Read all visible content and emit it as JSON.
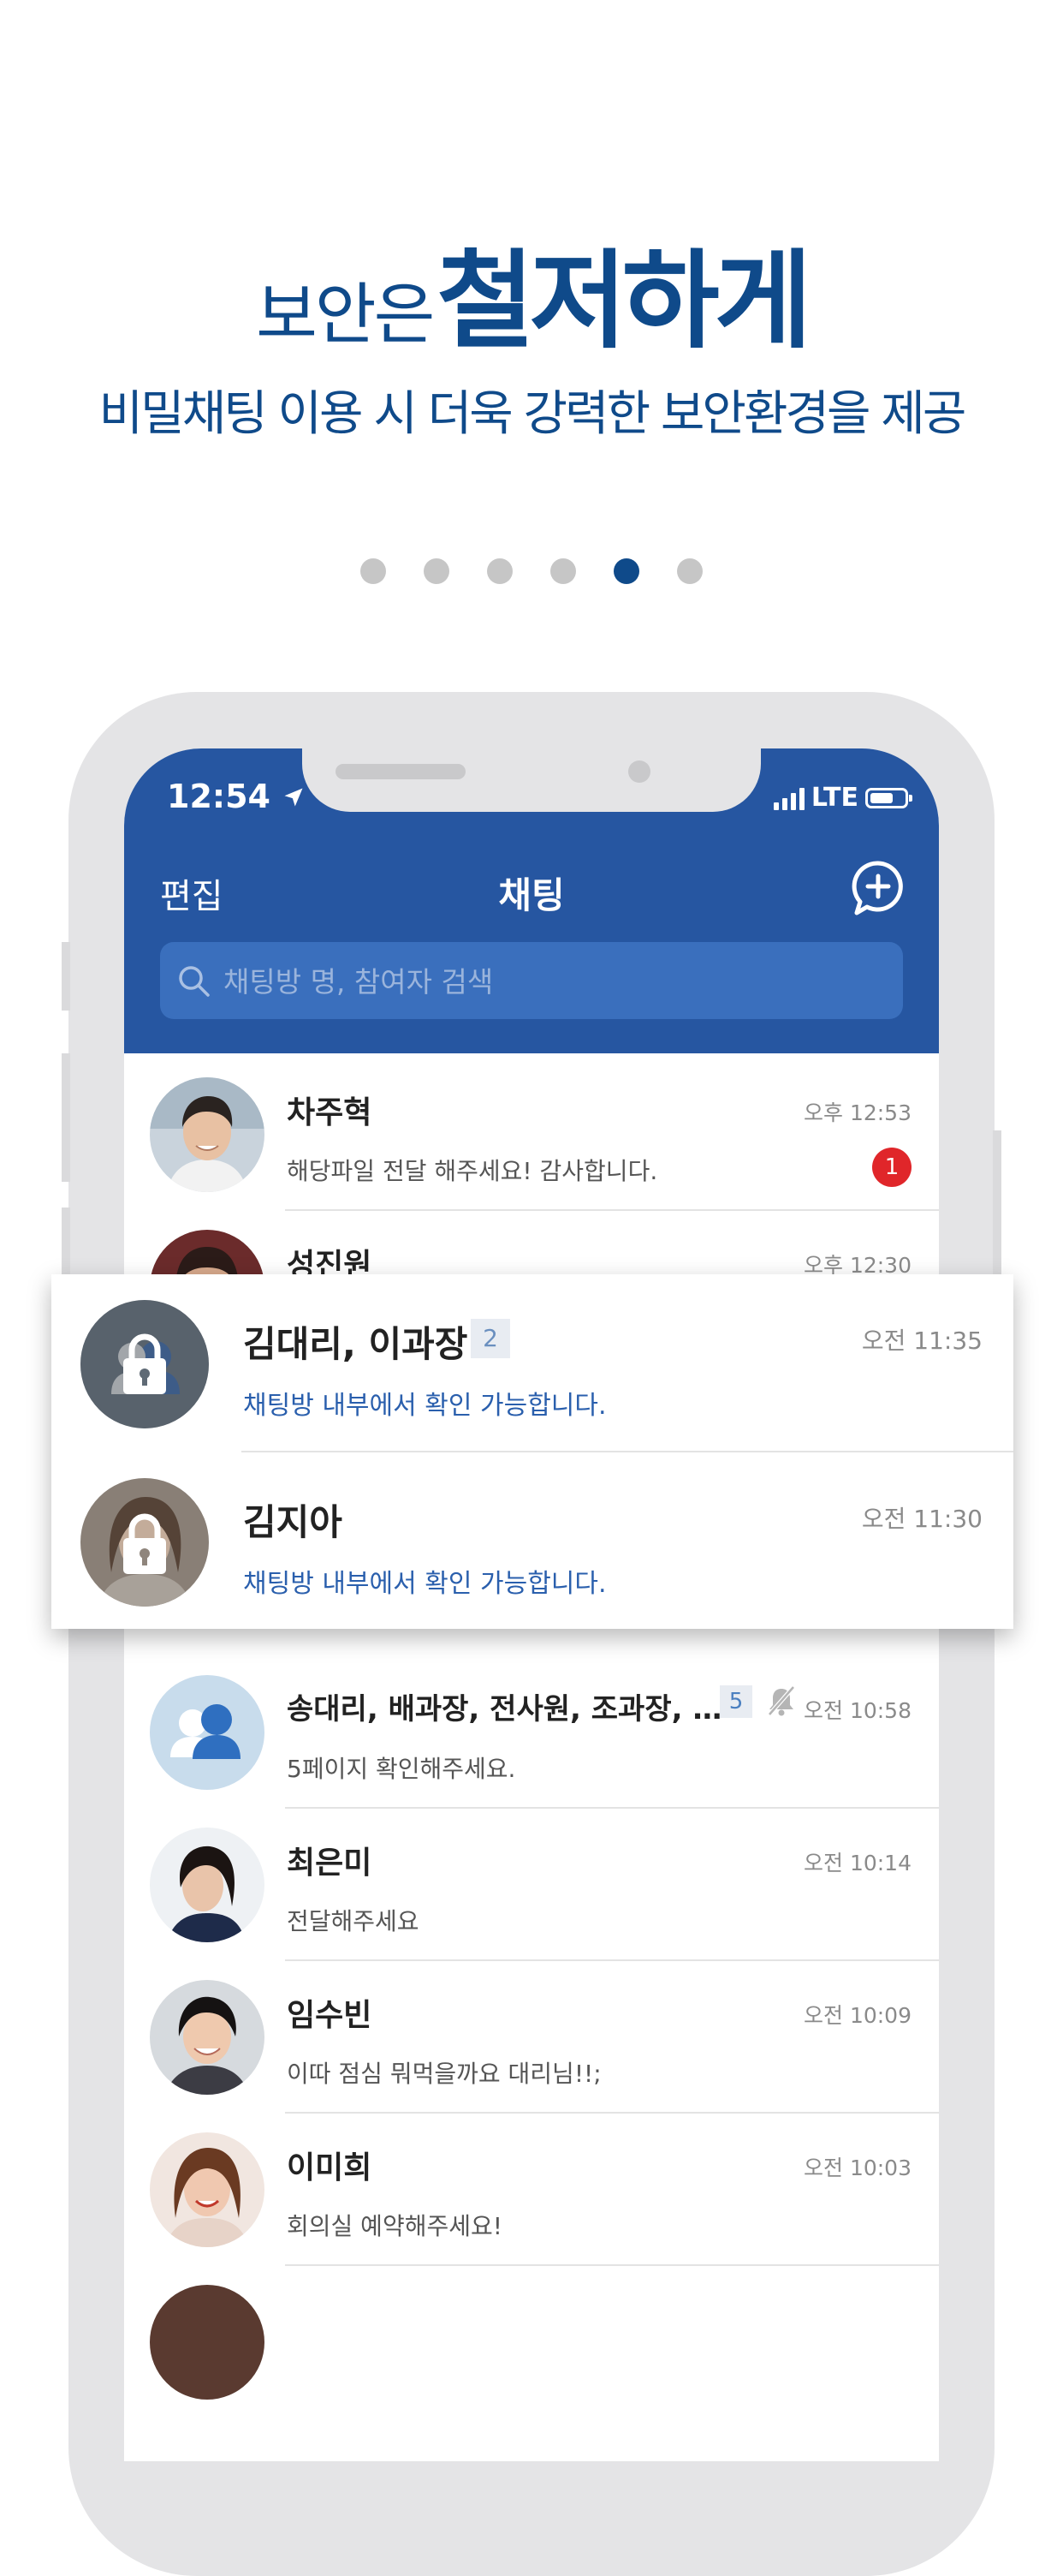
{
  "promo": {
    "headline_small": "보안은",
    "headline_big": "철저하게",
    "subheadline": "비밀채팅 이용 시 더욱 강력한 보안환경을 제공",
    "page_dots": 6,
    "active_dot": 5
  },
  "status_bar": {
    "time": "12:54",
    "network": "LTE",
    "location_icon": "location-arrow-icon"
  },
  "nav": {
    "edit_label": "편집",
    "title": "채팅",
    "add_icon": "chat-plus-icon"
  },
  "search": {
    "placeholder": "채팅방 명, 참여자 검색"
  },
  "chats_top": [
    {
      "name": "차주혁",
      "message": "해당파일 전달 해주세요! 감사합니다.",
      "time": "오후 12:53",
      "unread": "1"
    },
    {
      "name": "성진원",
      "time": "오후 12:30"
    }
  ],
  "secret_chats": [
    {
      "name": "김대리, 이과장",
      "count": "2",
      "message": "채팅방 내부에서 확인 가능합니다.",
      "time": "오전 11:35"
    },
    {
      "name": "김지아",
      "message": "채팅방 내부에서 확인 가능합니다.",
      "time": "오전 11:30"
    }
  ],
  "chats_bottom": [
    {
      "name": "송대리, 배과장, 전사원, 조과장, …",
      "count": "5",
      "muted": true,
      "message": "5페이지 확인해주세요.",
      "time": "오전 10:58"
    },
    {
      "name": "최은미",
      "message": "전달해주세요",
      "time": "오전 10:14"
    },
    {
      "name": "임수빈",
      "message": "이따 점심 뭐먹을까요 대리님!!;",
      "time": "오전 10:09"
    },
    {
      "name": "이미희",
      "message": "회의실 예약해주세요!",
      "time": "오전 10:03"
    }
  ],
  "colors": {
    "brand_blue": "#2656a1",
    "headline_blue": "#0f4a8a",
    "unread_red": "#e0262a",
    "secret_message_blue": "#2a5fad"
  }
}
